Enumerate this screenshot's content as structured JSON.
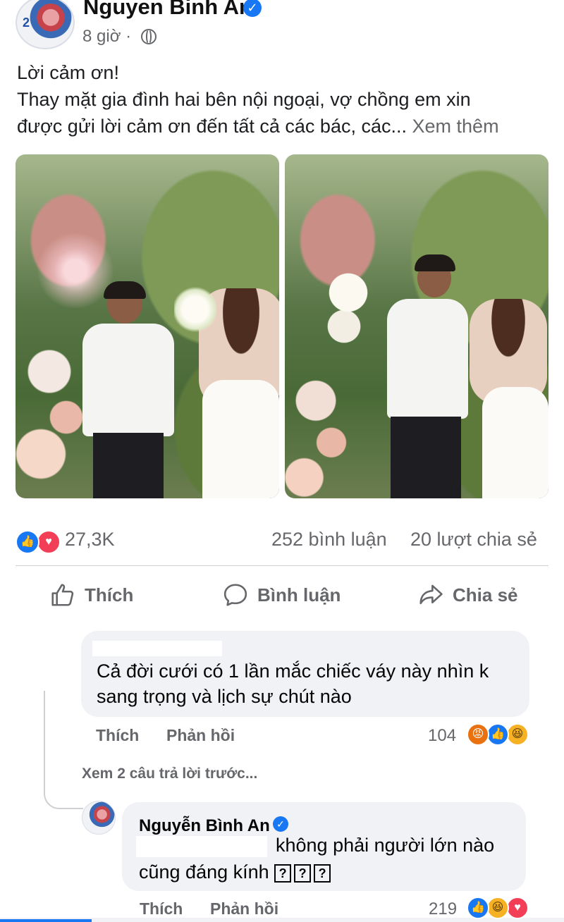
{
  "post": {
    "author": "Nguyen Binh An",
    "time": "8 giờ ·",
    "text_lines": [
      "Lời cảm ơn!",
      "Thay mặt gia đình hai bên nội ngoại, vợ chồng em xin",
      "được gửi lời cảm ơn đến tất cả các bác, các..."
    ],
    "see_more": "Xem thêm",
    "reactions_count": "27,3K",
    "comments_count": "252 bình luận",
    "shares_count": "20 lượt chia sẻ"
  },
  "actions": {
    "like": "Thích",
    "comment": "Bình luận",
    "share": "Chia sẻ"
  },
  "comment1": {
    "line1": "Cả đời cưới có 1 lần mắc chiếc váy này nhìn k",
    "line2": "sang trọng và lịch sự chút nào",
    "like_label": "Thích",
    "reply_label": "Phản hồi",
    "reaction_count": "104"
  },
  "view_previous_replies": "Xem 2 câu trả lời trước...",
  "reply1": {
    "author": "Nguyễn Bình An",
    "line1": "không phải người lớn nào",
    "line2": "cũng đáng kính",
    "emoji_boxes": [
      "?",
      "?",
      "?"
    ],
    "like_label": "Thích",
    "reply_label": "Phản hồi",
    "reaction_count": "219"
  },
  "colors": {
    "facebook_blue": "#1877f2",
    "love_red": "#f33e58",
    "muted_text": "#65676b",
    "bubble_bg": "#f0f2f5"
  },
  "icons": [
    "verified-badge-icon",
    "globe-icon",
    "like-reaction-icon",
    "love-reaction-icon",
    "angry-reaction-icon",
    "haha-reaction-icon",
    "thumbs-up-icon",
    "comment-icon",
    "share-icon"
  ]
}
